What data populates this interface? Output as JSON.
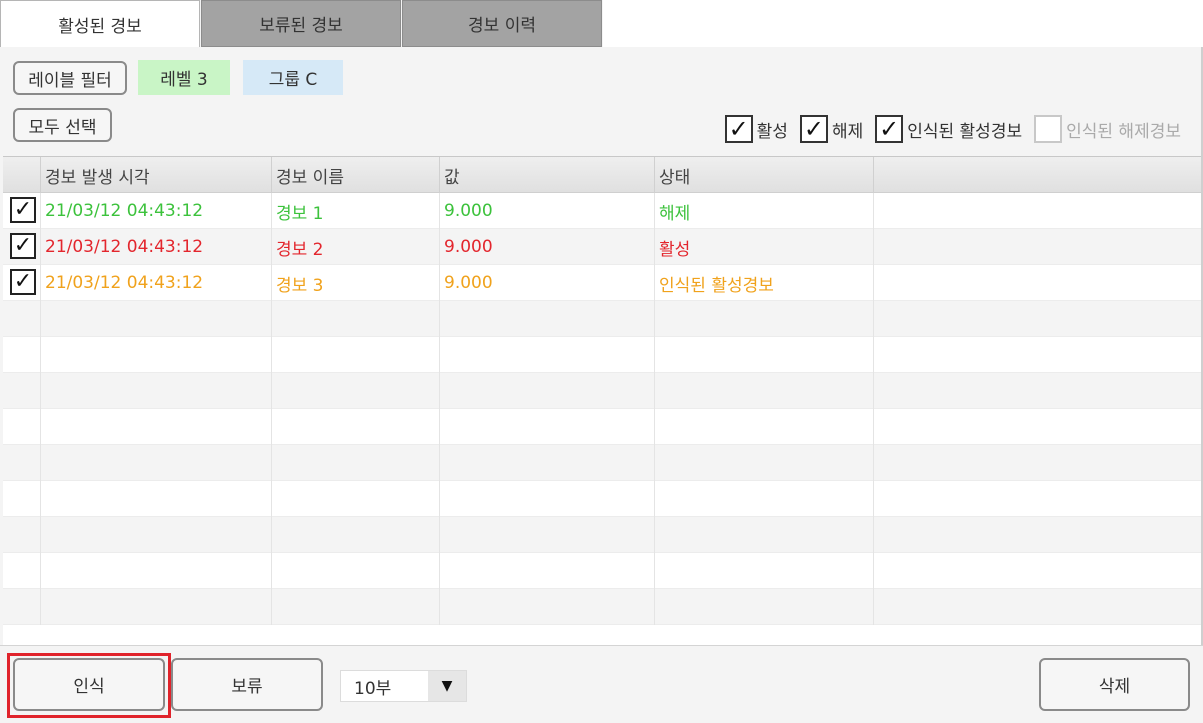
{
  "tabs": [
    {
      "label": "활성된 경보",
      "active": true
    },
    {
      "label": "보류된 경보",
      "active": false
    },
    {
      "label": "경보 이력",
      "active": false
    }
  ],
  "toolbar": {
    "label_filter": "레이블 필터",
    "level_chip": "레벨 3",
    "group_chip": "그룹 C",
    "select_all": "모두 선택"
  },
  "filters": [
    {
      "label": "활성",
      "checked": true,
      "enabled": true
    },
    {
      "label": "해제",
      "checked": true,
      "enabled": true
    },
    {
      "label": "인식된 활성경보",
      "checked": true,
      "enabled": true
    },
    {
      "label": "인식된 해제경보",
      "checked": false,
      "enabled": false
    }
  ],
  "table": {
    "columns": [
      "경보 발생 시각",
      "경보 이름",
      "값",
      "상태"
    ],
    "rows": [
      {
        "time": "21/03/12 04:43:12",
        "name": "경보 1",
        "value": "9.000",
        "status": "해제",
        "checked": true,
        "color": "#3cc23c"
      },
      {
        "time": "21/03/12 04:43:12",
        "name": "경보 2",
        "value": "9.000",
        "status": "활성",
        "checked": true,
        "color": "#e3262d"
      },
      {
        "time": "21/03/12 04:43:12",
        "name": "경보 3",
        "value": "9.000",
        "status": "인식된 활성경보",
        "checked": true,
        "color": "#f0a21c"
      }
    ]
  },
  "footer": {
    "ack_button": "인식",
    "hold_button": "보류",
    "duration_select": "10부",
    "delete_button": "삭제"
  },
  "icons": {
    "checkmark": "✓",
    "dropdown": "▼"
  },
  "colors": {
    "focus": "#e0232b",
    "level_chip": "#c9f5c6",
    "group_chip": "#d6e9f7"
  }
}
